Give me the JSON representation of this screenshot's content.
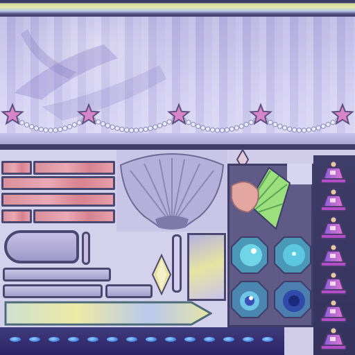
{
  "scene": {
    "type": "texture-atlas",
    "theme": "lavender stage curtain",
    "colors": {
      "curtain": "#c9c3ec",
      "frame": "#3f3c68",
      "plank": "#e39ea9",
      "gem_cyan": "#5fd2e6",
      "gem_blue": "#3a4fb8",
      "bell": "#c85bd6",
      "fan": "#7fd96a",
      "droplet": "#4f8ee8"
    },
    "icons": [
      "star-icon",
      "pearl-garland",
      "shell-fan-icon",
      "gem-icon",
      "bell-icon",
      "droplet-icon",
      "diamond-icon"
    ],
    "star_count": 5,
    "gem_count": 4,
    "bell_count": 7,
    "droplet_count": 14,
    "plank_count": 4
  }
}
